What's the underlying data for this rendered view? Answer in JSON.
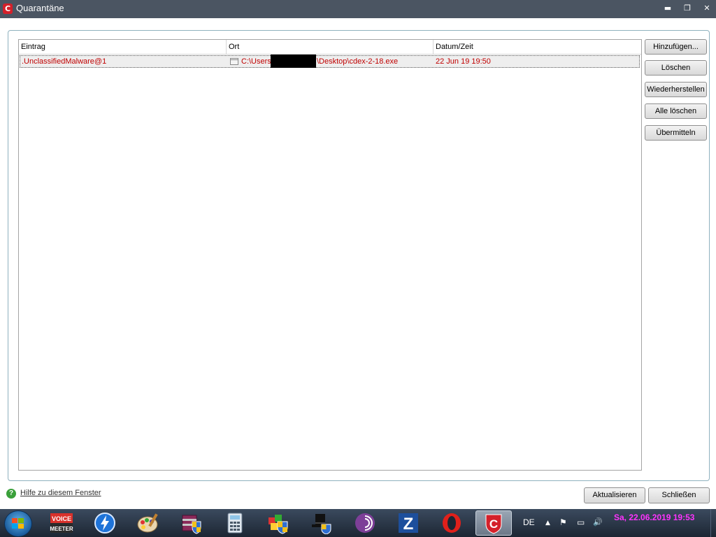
{
  "window": {
    "title": "Quarantäne",
    "app_icon_letter": "C",
    "controls": {
      "minimize": "▬",
      "maximize": "❐",
      "close": "✕"
    }
  },
  "list": {
    "columns": [
      "Eintrag",
      "Ort",
      "Datum/Zeit"
    ],
    "rows": [
      {
        "entry": ".UnclassifiedMalware@1",
        "path_prefix": "C:\\Users",
        "path_suffix": "\\Desktop\\cdex-2-18.exe",
        "datetime": "22 Jun 19 19:50"
      }
    ],
    "row_text_color": "#c00000"
  },
  "buttons": {
    "add": "Hinzufügen...",
    "delete": "Löschen",
    "restore": "Wiederherstellen",
    "delete_all": "Alle löschen",
    "submit": "Übermitteln",
    "refresh": "Aktualisieren",
    "close": "Schließen"
  },
  "help": {
    "icon": "?",
    "label": "Hilfe zu diesem Fenster"
  },
  "taskbar": {
    "items": [
      "start-orb",
      "voicemeeter",
      "thunderbolt-app",
      "paint-palette",
      "winrar-shield",
      "calculator",
      "installer-shield",
      "top-hat-shield",
      "tor-browser",
      "zonealarm",
      "opera",
      "comodo"
    ],
    "voicemeeter_top": "VOICE",
    "voicemeeter_bottom": "MEETER",
    "zonealarm_letter": "Z",
    "opera_letter": "O",
    "comodo_letter": "C",
    "language": "DE",
    "tray_icons": {
      "arrow": "▲",
      "flag": "⚑",
      "network": "▭",
      "volume": "🔊"
    },
    "clock": "Sa, 22.06.2019 19:53"
  }
}
